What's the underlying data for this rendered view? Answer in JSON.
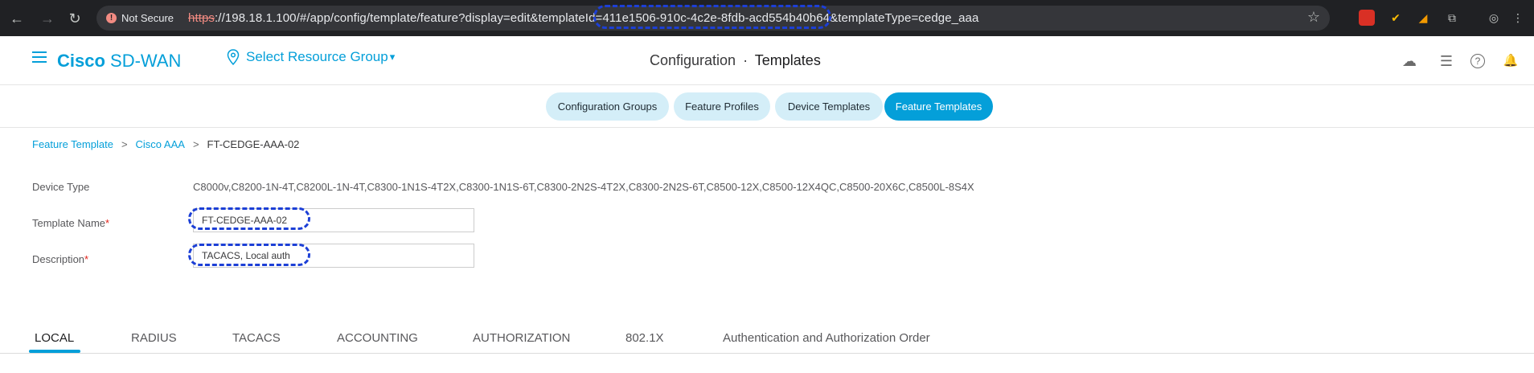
{
  "browser": {
    "back_icon": "←",
    "forward_icon": "→",
    "reload_icon": "↻",
    "security_label": "Not Secure",
    "url_scheme": "https",
    "url_rest": "://198.18.1.100/#/app/config/template/feature?display=edit&templateId=411e1506-910c-4c2e-8fdb-acd554b40b64&templateType=cedge_aaa",
    "star_icon": "☆",
    "profile_icon": "◎",
    "menu_icon": "⋮"
  },
  "header": {
    "brand_bold": "Cisco",
    "brand_rest": " SD-WAN",
    "resource_group": "Select Resource Group",
    "resource_caret": "▾",
    "title_part1": "Configuration",
    "title_sep": "·",
    "title_part2": "Templates",
    "cloud_icon": "☁",
    "list_icon": "☰",
    "help_icon": "?",
    "bell_icon": "🔔"
  },
  "pills": [
    {
      "label": "Configuration Groups",
      "active": false
    },
    {
      "label": "Feature Profiles",
      "active": false
    },
    {
      "label": "Device Templates",
      "active": false
    },
    {
      "label": "Feature Templates",
      "active": true
    }
  ],
  "breadcrumb": {
    "item1": "Feature Template",
    "item2": "Cisco AAA",
    "current": "FT-CEDGE-AAA-02",
    "sep": ">"
  },
  "form": {
    "device_type_label": "Device Type",
    "device_type_value": "C8000v,C8200-1N-4T,C8200L-1N-4T,C8300-1N1S-4T2X,C8300-1N1S-6T,C8300-2N2S-4T2X,C8300-2N2S-6T,C8500-12X,C8500-12X4QC,C8500-20X6C,C8500L-8S4X",
    "template_name_label": "Template Name",
    "template_name_value": "FT-CEDGE-AAA-02",
    "description_label": "Description",
    "description_value": "TACACS, Local auth",
    "required_mark": "*"
  },
  "sub_tabs": [
    {
      "label": "LOCAL",
      "active": true
    },
    {
      "label": "RADIUS",
      "active": false
    },
    {
      "label": "TACACS",
      "active": false
    },
    {
      "label": "ACCOUNTING",
      "active": false
    },
    {
      "label": "AUTHORIZATION",
      "active": false
    },
    {
      "label": "802.1X",
      "active": false
    },
    {
      "label": "Authentication and Authorization Order",
      "active": false
    }
  ],
  "colors": {
    "accent": "#049fd9",
    "pill_bg": "#d4eef8",
    "highlight": "#1c3fd6",
    "required": "#e2231a"
  }
}
